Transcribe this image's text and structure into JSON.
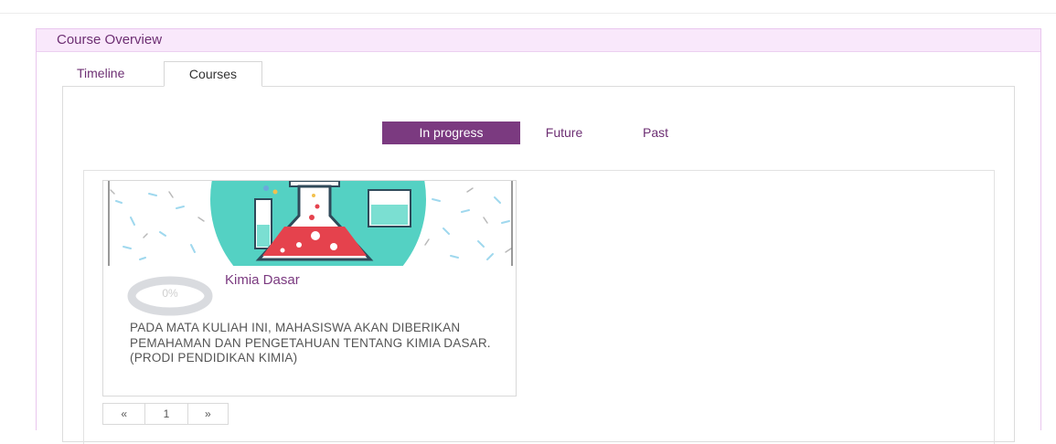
{
  "block": {
    "title": "Course Overview",
    "tabs": [
      {
        "label": "Timeline",
        "active": false
      },
      {
        "label": "Courses",
        "active": true
      }
    ]
  },
  "filters": [
    {
      "label": "In progress",
      "active": true
    },
    {
      "label": "Future",
      "active": false
    },
    {
      "label": "Past",
      "active": false
    }
  ],
  "courses": [
    {
      "name": "Kimia Dasar",
      "progress_percent": 0,
      "progress_label": "0%",
      "summary": "PADA MATA KULIAH INI, MAHASISWA AKAN DIBERIKAN PEMAHAMAN DAN PENGETAHUAN TENTANG KIMIA DASAR. (PRODI PENDIDIKAN KIMIA)",
      "image_icon": "chemistry-flask-icon"
    }
  ],
  "pagination": {
    "prev": "«",
    "current_page": "1",
    "next": "»"
  },
  "colors": {
    "accent": "#7b3a80",
    "header_bg": "#f9e8fb",
    "flask_red": "#e5424d",
    "image_teal": "#54d1c3"
  }
}
